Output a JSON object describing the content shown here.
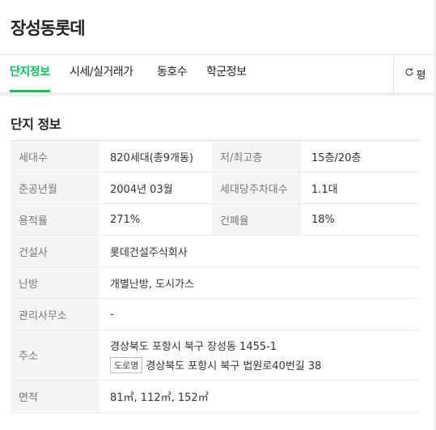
{
  "header": {
    "title": "장성동롯데"
  },
  "tabs": [
    {
      "label": "단지정보",
      "active": true
    },
    {
      "label": "시세/실거래가"
    },
    {
      "label": "동호수"
    },
    {
      "label": "학군정보"
    }
  ],
  "unit_toggle": {
    "label": "평",
    "icon": "refresh-icon"
  },
  "section": {
    "title": "단지 정보"
  },
  "info": {
    "households_label": "세대수",
    "households_value": "820세대(총9개동)",
    "floors_label": "저/최고층",
    "floors_value": "15층/20층",
    "completion_label": "준공년월",
    "completion_value": "2004년 03월",
    "parking_label": "세대당주차대수",
    "parking_value": "1.1대",
    "far_label": "용적률",
    "far_value": "271%",
    "bcr_label": "건폐율",
    "bcr_value": "18%",
    "builder_label": "건설사",
    "builder_value": "롯데건설주식회사",
    "heating_label": "난방",
    "heating_value": "개별난방, 도시가스",
    "office_label": "관리사무소",
    "office_value": "-",
    "address_label": "주소",
    "address_lot": "경상북도 포항시 북구 장성동 1455-1",
    "address_road_badge": "도로명",
    "address_road": "경상북도 포항시 북구 법원로40번길 38",
    "area_label": "면적",
    "area_value": "81㎡, 112㎡, 152㎡"
  },
  "colors": {
    "accent": "#03c75a",
    "label_bg": "#f5f5f5"
  }
}
